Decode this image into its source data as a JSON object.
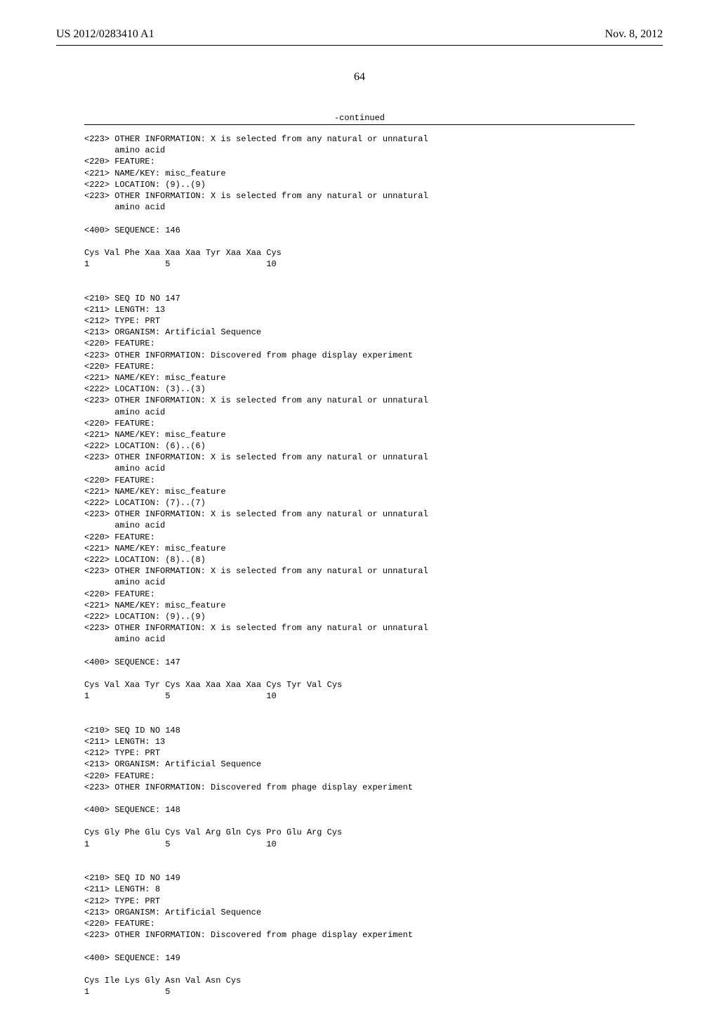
{
  "header": {
    "pub_number": "US 2012/0283410 A1",
    "pub_date": "Nov. 8, 2012"
  },
  "page_number": "64",
  "continued_label": "-continued",
  "lines": [
    "<223> OTHER INFORMATION: X is selected from any natural or unnatural",
    "      amino acid",
    "<220> FEATURE:",
    "<221> NAME/KEY: misc_feature",
    "<222> LOCATION: (9)..(9)",
    "<223> OTHER INFORMATION: X is selected from any natural or unnatural",
    "      amino acid",
    "",
    "<400> SEQUENCE: 146",
    "",
    "Cys Val Phe Xaa Xaa Xaa Tyr Xaa Xaa Cys",
    "1               5                   10",
    "",
    "",
    "<210> SEQ ID NO 147",
    "<211> LENGTH: 13",
    "<212> TYPE: PRT",
    "<213> ORGANISM: Artificial Sequence",
    "<220> FEATURE:",
    "<223> OTHER INFORMATION: Discovered from phage display experiment",
    "<220> FEATURE:",
    "<221> NAME/KEY: misc_feature",
    "<222> LOCATION: (3)..(3)",
    "<223> OTHER INFORMATION: X is selected from any natural or unnatural",
    "      amino acid",
    "<220> FEATURE:",
    "<221> NAME/KEY: misc_feature",
    "<222> LOCATION: (6)..(6)",
    "<223> OTHER INFORMATION: X is selected from any natural or unnatural",
    "      amino acid",
    "<220> FEATURE:",
    "<221> NAME/KEY: misc_feature",
    "<222> LOCATION: (7)..(7)",
    "<223> OTHER INFORMATION: X is selected from any natural or unnatural",
    "      amino acid",
    "<220> FEATURE:",
    "<221> NAME/KEY: misc_feature",
    "<222> LOCATION: (8)..(8)",
    "<223> OTHER INFORMATION: X is selected from any natural or unnatural",
    "      amino acid",
    "<220> FEATURE:",
    "<221> NAME/KEY: misc_feature",
    "<222> LOCATION: (9)..(9)",
    "<223> OTHER INFORMATION: X is selected from any natural or unnatural",
    "      amino acid",
    "",
    "<400> SEQUENCE: 147",
    "",
    "Cys Val Xaa Tyr Cys Xaa Xaa Xaa Xaa Cys Tyr Val Cys",
    "1               5                   10",
    "",
    "",
    "<210> SEQ ID NO 148",
    "<211> LENGTH: 13",
    "<212> TYPE: PRT",
    "<213> ORGANISM: Artificial Sequence",
    "<220> FEATURE:",
    "<223> OTHER INFORMATION: Discovered from phage display experiment",
    "",
    "<400> SEQUENCE: 148",
    "",
    "Cys Gly Phe Glu Cys Val Arg Gln Cys Pro Glu Arg Cys",
    "1               5                   10",
    "",
    "",
    "<210> SEQ ID NO 149",
    "<211> LENGTH: 8",
    "<212> TYPE: PRT",
    "<213> ORGANISM: Artificial Sequence",
    "<220> FEATURE:",
    "<223> OTHER INFORMATION: Discovered from phage display experiment",
    "",
    "<400> SEQUENCE: 149",
    "",
    "Cys Ile Lys Gly Asn Val Asn Cys",
    "1               5"
  ]
}
